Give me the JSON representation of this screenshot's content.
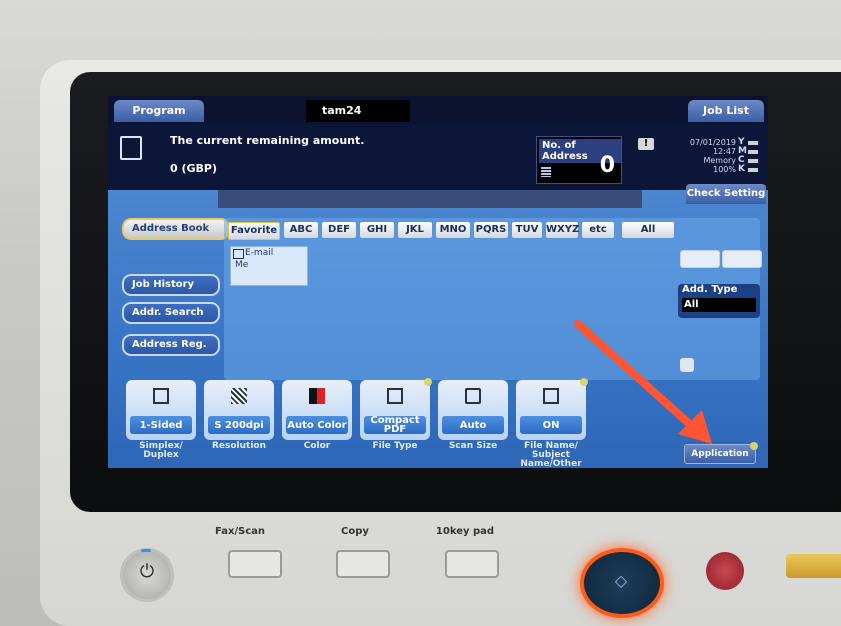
{
  "screen": {
    "tab_program": "Program",
    "user": "tam24",
    "tab_job_list": "Job List",
    "message_line1": "The current remaining amount.",
    "message_line2": "0 (GBP)",
    "no_of_address_label": "No. of Address",
    "no_of_address_value": "0",
    "warning_icon": "!",
    "date": "07/01/2019",
    "time": "12:47",
    "memory_label": "Memory",
    "memory_value": "100%",
    "toner": [
      "Y",
      "M",
      "C",
      "K"
    ],
    "check_setting": "Check Setting"
  },
  "left_menu": {
    "address_book": "Address Book",
    "job_history": "Job History",
    "addr_search": "Addr. Search",
    "address_reg": "Address Reg."
  },
  "index_tabs": [
    "Favorite",
    "ABC",
    "DEF",
    "GHI",
    "JKL",
    "MNO",
    "PQRS",
    "TUV",
    "WXYZ",
    "etc",
    "All"
  ],
  "entries": [
    {
      "type": "E-mail",
      "name": "Me"
    }
  ],
  "add_type": {
    "label": "Add. Type",
    "value": "All"
  },
  "functions": [
    {
      "value": "1-Sided",
      "label": "Simplex/ Duplex",
      "icon": "duplex-icon"
    },
    {
      "value": "S 200dpi",
      "label": "Resolution",
      "icon": "resolution-icon"
    },
    {
      "value": "Auto Color",
      "label": "Color",
      "icon": "color-icon"
    },
    {
      "value": "Compact PDF",
      "label": "File Type",
      "icon": "pdf-icon"
    },
    {
      "value": "Auto",
      "label": "Scan Size",
      "icon": "scan-size-icon"
    },
    {
      "value": "ON",
      "label": "File Name/ Subject Name/Other",
      "icon": "email-icon"
    }
  ],
  "application_button": "Application",
  "hardware": {
    "fax_scan": "Fax/Scan",
    "copy": "Copy",
    "tenkey": "10key pad"
  },
  "colors": {
    "screen_bg": "#3774c4",
    "header_bg": "#0b1330",
    "arrow": "#ff5533",
    "start_ring": "#ff5a1a"
  }
}
